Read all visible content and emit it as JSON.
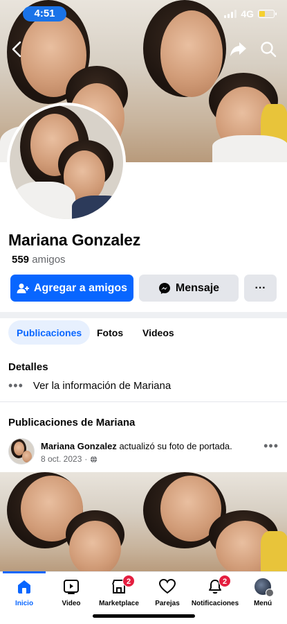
{
  "status_bar": {
    "time": "4:51",
    "network": "4G"
  },
  "profile": {
    "name": "Mariana Gonzalez",
    "friends_count": "559",
    "friends_label": "amigos"
  },
  "actions": {
    "add_friend": "Agregar a amigos",
    "message": "Mensaje",
    "more": "···"
  },
  "tabs": [
    {
      "label": "Publicaciones",
      "active": true
    },
    {
      "label": "Fotos",
      "active": false
    },
    {
      "label": "Videos",
      "active": false
    }
  ],
  "details": {
    "heading": "Detalles",
    "info_link": "Ver la información de Mariana"
  },
  "posts": {
    "heading": "Publicaciones de Mariana",
    "item": {
      "author": "Mariana Gonzalez",
      "action": "actualizó su foto de portada.",
      "date": "8 oct. 2023",
      "separator": "·",
      "privacy_icon": "globe-icon"
    }
  },
  "bottom_nav": {
    "items": [
      {
        "label": "Inicio",
        "icon": "home-icon",
        "active": true,
        "badge": ""
      },
      {
        "label": "Video",
        "icon": "video-icon",
        "active": false,
        "badge": ""
      },
      {
        "label": "Marketplace",
        "icon": "marketplace-icon",
        "active": false,
        "badge": "2"
      },
      {
        "label": "Parejas",
        "icon": "heart-icon",
        "active": false,
        "badge": ""
      },
      {
        "label": "Notificaciones",
        "icon": "bell-icon",
        "active": false,
        "badge": "2"
      },
      {
        "label": "Menú",
        "icon": "menu-avatar",
        "active": false,
        "badge": ""
      }
    ]
  },
  "colors": {
    "accent": "#0866ff",
    "badge": "#e41e3f",
    "time_pill": "#1a73e8"
  }
}
